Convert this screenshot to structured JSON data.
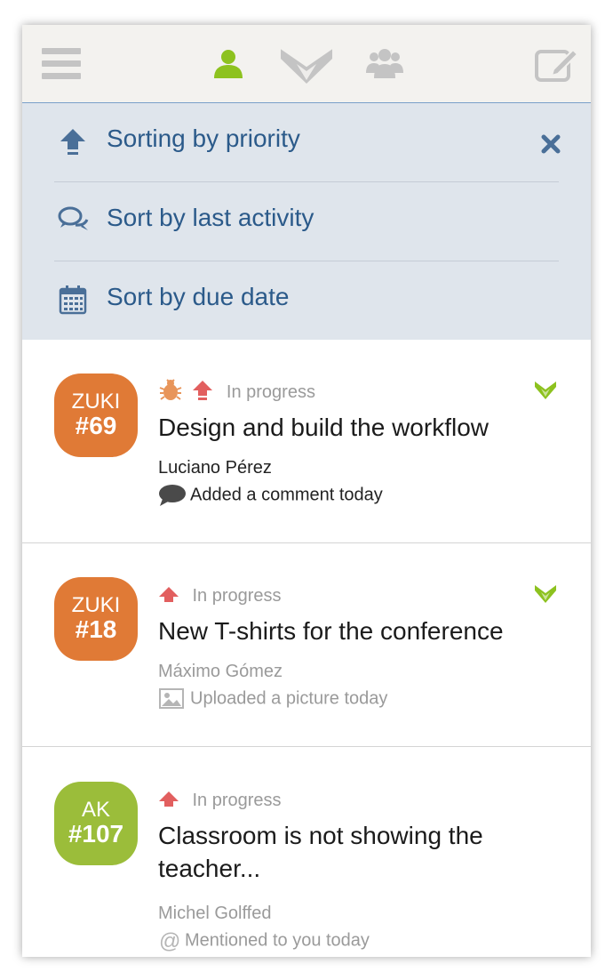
{
  "topbar": {
    "icons": [
      "menu-icon",
      "user-icon",
      "app-logo-icon",
      "group-icon",
      "compose-icon"
    ],
    "colors": {
      "active": "#8dc21f",
      "inactive": "#c4c4c4"
    }
  },
  "sort_menu": {
    "items": [
      {
        "label": "Sorting by priority",
        "icon": "priority-arrow-icon"
      },
      {
        "label": "Sort by last activity",
        "icon": "chat-bubbles-icon"
      },
      {
        "label": "Sort by due date",
        "icon": "calendar-icon"
      }
    ],
    "close_icon": "close-icon",
    "colors": {
      "background": "#dfe5ec",
      "text": "#2b5a8a"
    }
  },
  "tasks": [
    {
      "project": "ZUKI",
      "number": "#69",
      "badge_color": "#e07a36",
      "type_icons": [
        "bug-icon",
        "priority-high-icon"
      ],
      "status": "In progress",
      "title": "Design and build the workflow",
      "person": "Luciano Pérez",
      "activity": "Added a comment today",
      "activity_icon": "comment-icon",
      "unread": true
    },
    {
      "project": "ZUKI",
      "number": "#18",
      "badge_color": "#e07a36",
      "type_icons": [
        "priority-high-icon"
      ],
      "status": "In progress",
      "title": "New T-shirts for the conference",
      "person": "Máximo Gómez",
      "activity": "Uploaded a picture today",
      "activity_icon": "picture-icon",
      "unread": false
    },
    {
      "project": "AK",
      "number": "#107",
      "badge_color": "#9bbd3a",
      "type_icons": [
        "priority-high-icon"
      ],
      "status": "In progress",
      "title": "Classroom is not showing the teacher...",
      "person": "Michel Golffed",
      "activity": "Mentioned to you today",
      "activity_icon": "at-sign-icon",
      "unread": false
    }
  ]
}
